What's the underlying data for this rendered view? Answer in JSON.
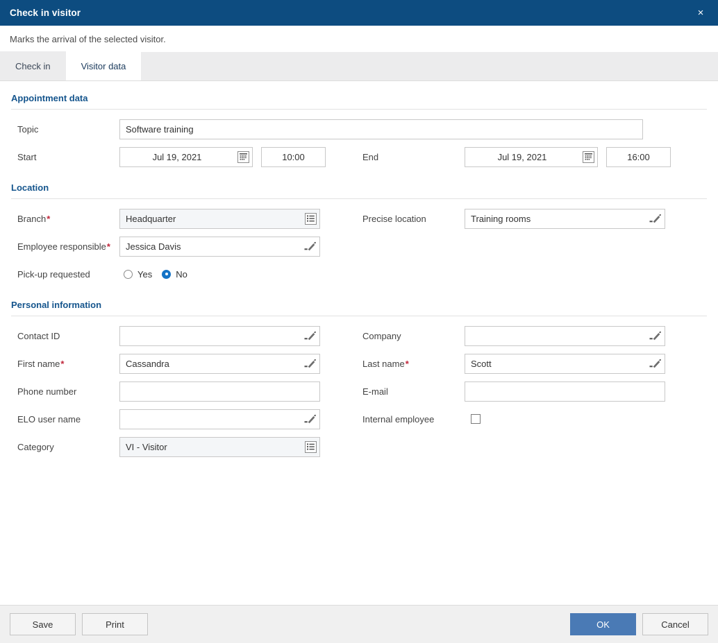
{
  "titlebar": {
    "title": "Check in visitor",
    "close_label": "×"
  },
  "subtitle": "Marks the arrival of the selected visitor.",
  "tabs": [
    {
      "label": "Check in",
      "active": false
    },
    {
      "label": "Visitor data",
      "active": true
    }
  ],
  "sections": {
    "appointment": {
      "header": "Appointment data",
      "topic": {
        "label": "Topic",
        "value": "Software training"
      },
      "start": {
        "label": "Start",
        "date": "Jul 19, 2021",
        "time": "10:00"
      },
      "end": {
        "label": "End",
        "date": "Jul 19, 2021",
        "time": "16:00"
      }
    },
    "location": {
      "header": "Location",
      "branch": {
        "label": "Branch",
        "required": "*",
        "value": "Headquarter"
      },
      "precise_location": {
        "label": "Precise location",
        "value": "Training rooms"
      },
      "employee_responsible": {
        "label": "Employee responsible",
        "required": "*",
        "value": "Jessica Davis"
      },
      "pickup": {
        "label": "Pick-up requested",
        "options": [
          {
            "label": "Yes",
            "selected": false
          },
          {
            "label": "No",
            "selected": true
          }
        ]
      }
    },
    "personal": {
      "header": "Personal information",
      "contact_id": {
        "label": "Contact ID",
        "value": ""
      },
      "company": {
        "label": "Company",
        "value": ""
      },
      "first_name": {
        "label": "First name",
        "required": "*",
        "value": "Cassandra"
      },
      "last_name": {
        "label": "Last name",
        "required": "*",
        "value": "Scott"
      },
      "phone_number": {
        "label": "Phone number",
        "value": ""
      },
      "email": {
        "label": "E-mail",
        "value": ""
      },
      "elo_user_name": {
        "label": "ELO user name",
        "value": ""
      },
      "internal_employee": {
        "label": "Internal employee",
        "checked": false
      },
      "category": {
        "label": "Category",
        "value": "VI - Visitor"
      }
    }
  },
  "footer": {
    "save": "Save",
    "print": "Print",
    "ok": "OK",
    "cancel": "Cancel"
  },
  "icons": {
    "calendar": "calendar-icon",
    "list_picker": "list-picker-icon",
    "pencil": "pencil-icon",
    "close": "close-icon"
  },
  "colors": {
    "titlebar": "#0d4c80",
    "section_header": "#15558d",
    "required": "#c0283c",
    "primary_button": "#4a7ab5",
    "radio_selected": "#1473c6",
    "readonly_field": "#f4f6f8"
  }
}
